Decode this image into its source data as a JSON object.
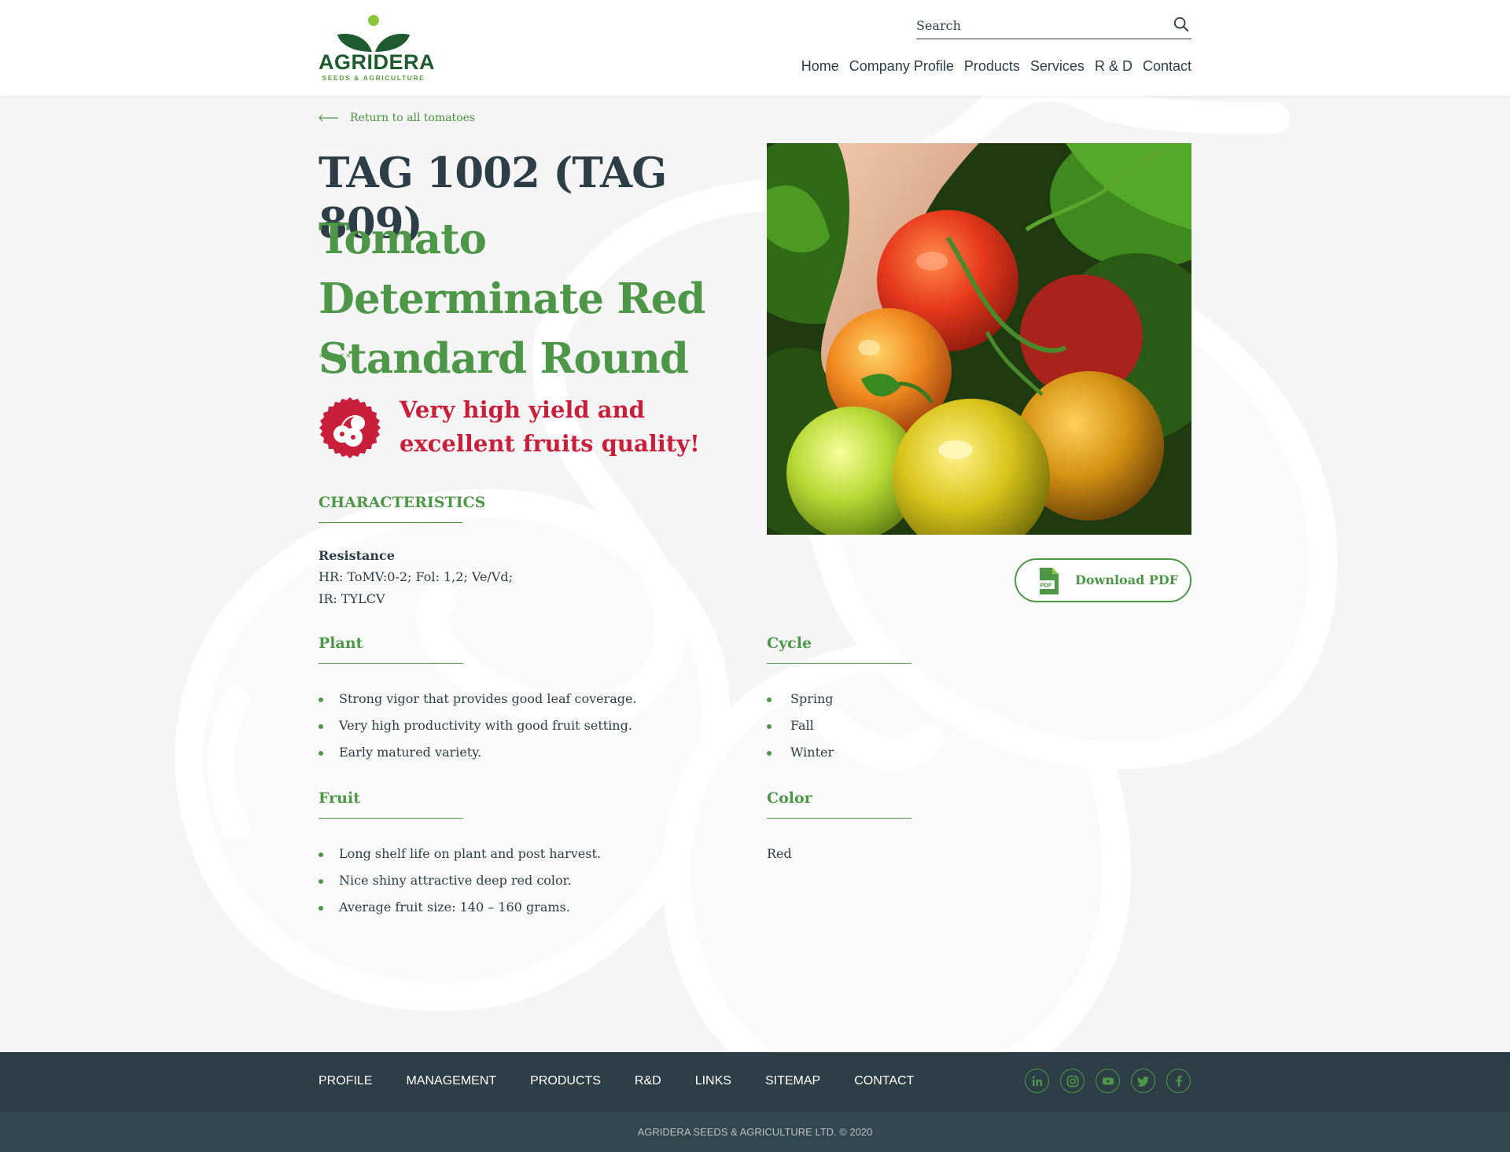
{
  "header": {
    "logo": {
      "name": "AGRIDERA",
      "tagline": "SEEDS & AGRICULTURE"
    },
    "search": {
      "placeholder": "Search"
    },
    "nav": [
      "Home",
      "Company Profile",
      "Products",
      "Services",
      "R & D",
      "Contact"
    ]
  },
  "main": {
    "back_link": "Return to all tomatoes",
    "title": "TAG 1002 (TAG 809)",
    "subtitle": "Tomato Determinate Red Standard Round",
    "rating_marks": "×××××",
    "highlight": "Very high yield and excellent fruits quality!",
    "characteristics": {
      "heading": "CHARACTERISTICS",
      "resistance_label": "Resistance",
      "resistance_hr": "HR: ToMV:0-2; Fol: 1,2; Ve/Vd;",
      "resistance_ir": "IR: TYLCV"
    },
    "plant": {
      "heading": "Plant",
      "items": [
        "Strong vigor that provides good leaf coverage.",
        "Very high productivity with good fruit setting.",
        "Early matured variety."
      ]
    },
    "fruit": {
      "heading": "Fruit",
      "items": [
        "Long shelf life on plant and post harvest.",
        "Nice shiny attractive deep red color.",
        "Average fruit size: 140 – 160 grams."
      ]
    },
    "cycle": {
      "heading": "Cycle",
      "items": [
        "Spring",
        "Fall",
        "Winter"
      ]
    },
    "color": {
      "heading": "Color",
      "value": "Red"
    },
    "download": {
      "label": "Download PDF",
      "icon_text": "PDF"
    }
  },
  "footer": {
    "nav": [
      "PROFILE",
      "MANAGEMENT",
      "PRODUCTS",
      "R&D",
      "LINKS",
      "SITEMAP",
      "CONTACT"
    ],
    "social": [
      "linkedin-icon",
      "instagram-icon",
      "youtube-icon",
      "twitter-icon",
      "facebook-icon"
    ],
    "copyright": "AGRIDERA SEEDS & AGRICULTURE LTD. © 2020"
  },
  "colors": {
    "brand_green": "#4e9748",
    "dark_green": "#1e5b2f",
    "text_dark": "#2d3e46",
    "highlight_red": "#c8203a",
    "footer_bg": "#2d3e46"
  }
}
